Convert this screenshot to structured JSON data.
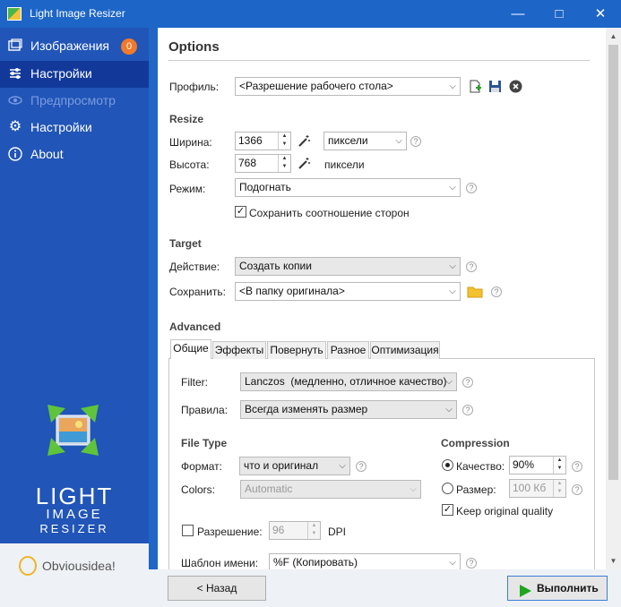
{
  "window": {
    "title": "Light Image Resizer",
    "minimize_glyph": "—",
    "maximize_glyph": "□",
    "close_glyph": "✕"
  },
  "sidebar": {
    "items": [
      {
        "label": "Изображения",
        "icon": "images-icon",
        "badge": "0"
      },
      {
        "label": "Настройки",
        "icon": "sliders-icon"
      },
      {
        "label": "Предпросмотр",
        "icon": "eye-icon"
      },
      {
        "label": "Настройки",
        "icon": "gear-icon"
      },
      {
        "label": "About",
        "icon": "info-icon"
      }
    ],
    "logo_lines": [
      "LIGHT",
      "IMAGE",
      "RESIZER"
    ],
    "footer_brand": "Obviousidea!"
  },
  "options": {
    "title": "Options",
    "profile_label": "Профиль:",
    "profile_value": "<Разрешение рабочего стола>",
    "resize": {
      "title": "Resize",
      "width_label": "Ширина:",
      "width_value": "1366",
      "width_unit": "пиксели",
      "height_label": "Высота:",
      "height_value": "768",
      "height_unit": "пиксели",
      "mode_label": "Режим:",
      "mode_value": "Подогнать",
      "keep_ratio_label": "Сохранить соотношение сторон"
    },
    "target": {
      "title": "Target",
      "action_label": "Действие:",
      "action_value": "Создать копии",
      "save_label": "Сохранить:",
      "save_value": "<В папку оригинала>"
    },
    "advanced": {
      "title": "Advanced",
      "tabs": [
        "Общие",
        "Эффекты",
        "Повернуть",
        "Разное",
        "Оптимизация"
      ],
      "filter_label": "Filter:",
      "filter_value": "Lanczos  (медленно, отличное качество)",
      "rules_label": "Правила:",
      "rules_value": "Всегда изменять размер",
      "filetype_title": "File Type",
      "format_label": "Формат:",
      "format_value": "что и оригинал",
      "colors_label": "Colors:",
      "colors_value": "Automatic",
      "compression_title": "Compression",
      "quality_label": "Качество:",
      "quality_value": "90%",
      "size_label": "Размер:",
      "size_value": "100 Кб",
      "keep_quality_label": "Keep original quality",
      "resolution_label": "Разрешение:",
      "resolution_value": "96",
      "resolution_unit": "DPI",
      "name_template_label": "Шаблон имени:",
      "name_template_value": "%F (Копировать)"
    }
  },
  "footer": {
    "back_label": "< Назад",
    "run_label": "Выполнить"
  },
  "colors": {
    "titlebar": "#1d66c8",
    "sidebar": "#2155b7",
    "sidebar_active": "#12399a",
    "badge": "#f07a2a",
    "run_icon": "#1ea61e"
  }
}
